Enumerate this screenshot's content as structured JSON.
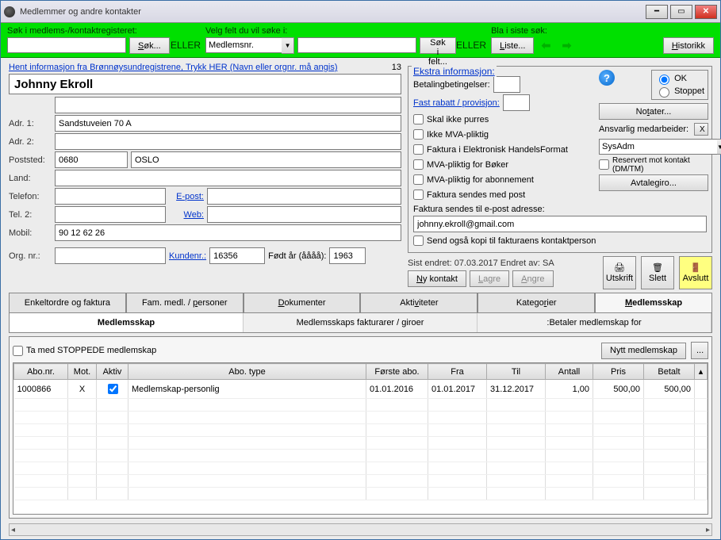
{
  "window": {
    "title": "Medlemmer og andre kontakter"
  },
  "search": {
    "lbl_reg": "Søk i  medlems-/kontaktregisteret:",
    "btn_search": "Søk...",
    "eller1": "ELLER",
    "lbl_field": "Velg felt du vil søke i:",
    "field_sel": "Medlemsnr.",
    "btn_field": "Søk i felt...",
    "eller2": "ELLER",
    "lbl_last": "Bla i siste søk:",
    "btn_list": "Liste...",
    "btn_hist": "Historikk"
  },
  "top": {
    "bregg_link": "Hent informasjon fra Brønnøysundregistrene, Trykk HER (Navn eller orgnr. må angis)",
    "count": "13",
    "name": "Johnny Ekroll"
  },
  "form": {
    "lbl_adr1": "Adr. 1:",
    "adr1": "Sandstuveien 70 A",
    "lbl_adr2": "Adr. 2:",
    "adr2": "",
    "lbl_post": "Poststed:",
    "post_code": "0680",
    "post_city": "OSLO",
    "lbl_land": "Land:",
    "land": "",
    "lbl_tel": "Telefon:",
    "tel": "",
    "lnk_epost": "E-post:",
    "epost": "",
    "lbl_tel2": "Tel. 2:",
    "tel2": "",
    "lnk_web": "Web:",
    "web": "",
    "lbl_mobil": "Mobil:",
    "mobil": "90 12 62 26",
    "lbl_org": "Org. nr.:",
    "org": "",
    "lnk_kund": "Kundenr.:",
    "kund": "16356",
    "lbl_fodt": "Født år (åååå):",
    "fodt": "1963"
  },
  "extra": {
    "header": "Ekstra informasjon:",
    "lbl_betaling": "Betalingbetingelser:",
    "lnk_rabatt": "Fast rabatt / provisjon:",
    "chk_purres": "Skal ikke purres",
    "chk_mva": "Ikke MVA-pliktig",
    "chk_ehf": "Faktura i Elektronisk HandelsFormat",
    "chk_boker": "MVA-pliktig for Bøker",
    "chk_abo": "MVA-pliktig for abonnement",
    "chk_post": "Faktura sendes med post",
    "lbl_epost": "Faktura sendes til e-post adresse:",
    "epost_val": "johnny.ekroll@gmail.com",
    "chk_kopi": "Send også kopi til fakturaens kontaktperson",
    "rad_ok": "OK",
    "rad_stoppet": "Stoppet",
    "btn_notater": "Notater...",
    "lbl_ansvarlig": "Ansvarlig medarbeider:",
    "ansvarlig": "SysAdm",
    "chk_reservert": "Reservert mot kontakt (DM/TM)",
    "btn_avtale": "Avtalegiro...",
    "x_btn": "X"
  },
  "status": {
    "sist_endret": "Sist endret: 07.03.2017 Endret av: SA",
    "btn_ny": "Ny kontakt",
    "btn_lagre": "Lagre",
    "btn_angre": "Angre",
    "btn_utskrift": "Utskrift",
    "btn_slett": "Slett",
    "btn_avslutt": "Avslutt"
  },
  "tabs": {
    "t1": "Enkeltordre og faktura",
    "t2": "Fam. medl. / personer",
    "t3": "Dokumenter",
    "t4": "Aktiviteter",
    "t5": "Kategorier",
    "t6": "Medlemsskap"
  },
  "subtabs": {
    "s1": "Medlemsskap",
    "s2": "Medlemsskaps fakturarer / giroer",
    "s3": ":Betaler medlemskap for"
  },
  "sub": {
    "chk_stoppede": "Ta med STOPPEDE medlemskap",
    "btn_nytt": "Nytt medlemskap",
    "btn_dots": "..."
  },
  "grid": {
    "cols": [
      "Abo.nr.",
      "Mot.",
      "Aktiv",
      "Abo. type",
      "Første abo.",
      "Fra",
      "Til",
      "Antall",
      "Pris",
      "Betalt"
    ],
    "row": {
      "abonr": "1000866",
      "mot": "X",
      "aktiv_checked": true,
      "type": "Medlemskap-personlig",
      "forste": "01.01.2016",
      "fra": "01.01.2017",
      "til": "31.12.2017",
      "antall": "1,00",
      "pris": "500,00",
      "betalt": "500,00"
    }
  }
}
